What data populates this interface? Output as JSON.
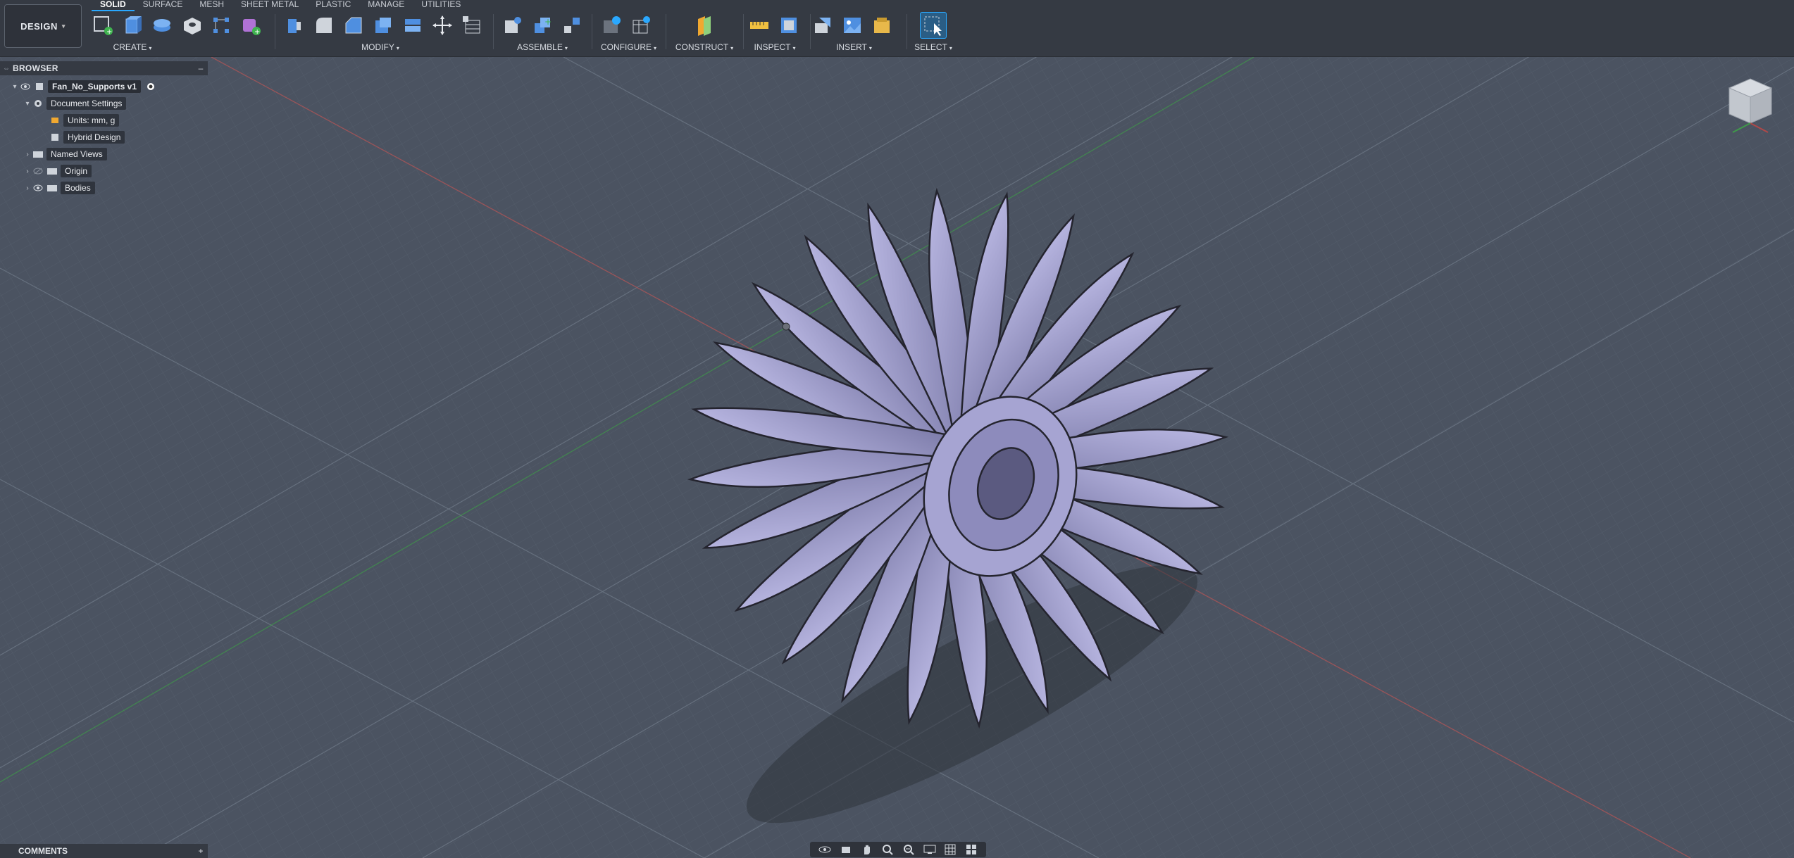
{
  "workspace": {
    "label": "DESIGN"
  },
  "tabs": [
    "SOLID",
    "SURFACE",
    "MESH",
    "SHEET METAL",
    "PLASTIC",
    "MANAGE",
    "UTILITIES"
  ],
  "active_tab": "SOLID",
  "groups": {
    "create": "CREATE",
    "modify": "MODIFY",
    "assemble": "ASSEMBLE",
    "configure": "CONFIGURE",
    "construct": "CONSTRUCT",
    "inspect": "INSPECT",
    "insert": "INSERT",
    "select": "SELECT"
  },
  "browser": {
    "title": "BROWSER",
    "root": "Fan_No_Supports v1",
    "items": [
      {
        "label": "Document Settings"
      },
      {
        "label": "Units: mm, g"
      },
      {
        "label": "Hybrid Design"
      },
      {
        "label": "Named Views"
      },
      {
        "label": "Origin"
      },
      {
        "label": "Bodies"
      }
    ]
  },
  "comments": {
    "title": "COMMENTS"
  },
  "colors": {
    "accent": "#2aa8ff",
    "toolbar": "#353a43",
    "canvas": "#4a5260",
    "model": "#9c9ac8"
  }
}
